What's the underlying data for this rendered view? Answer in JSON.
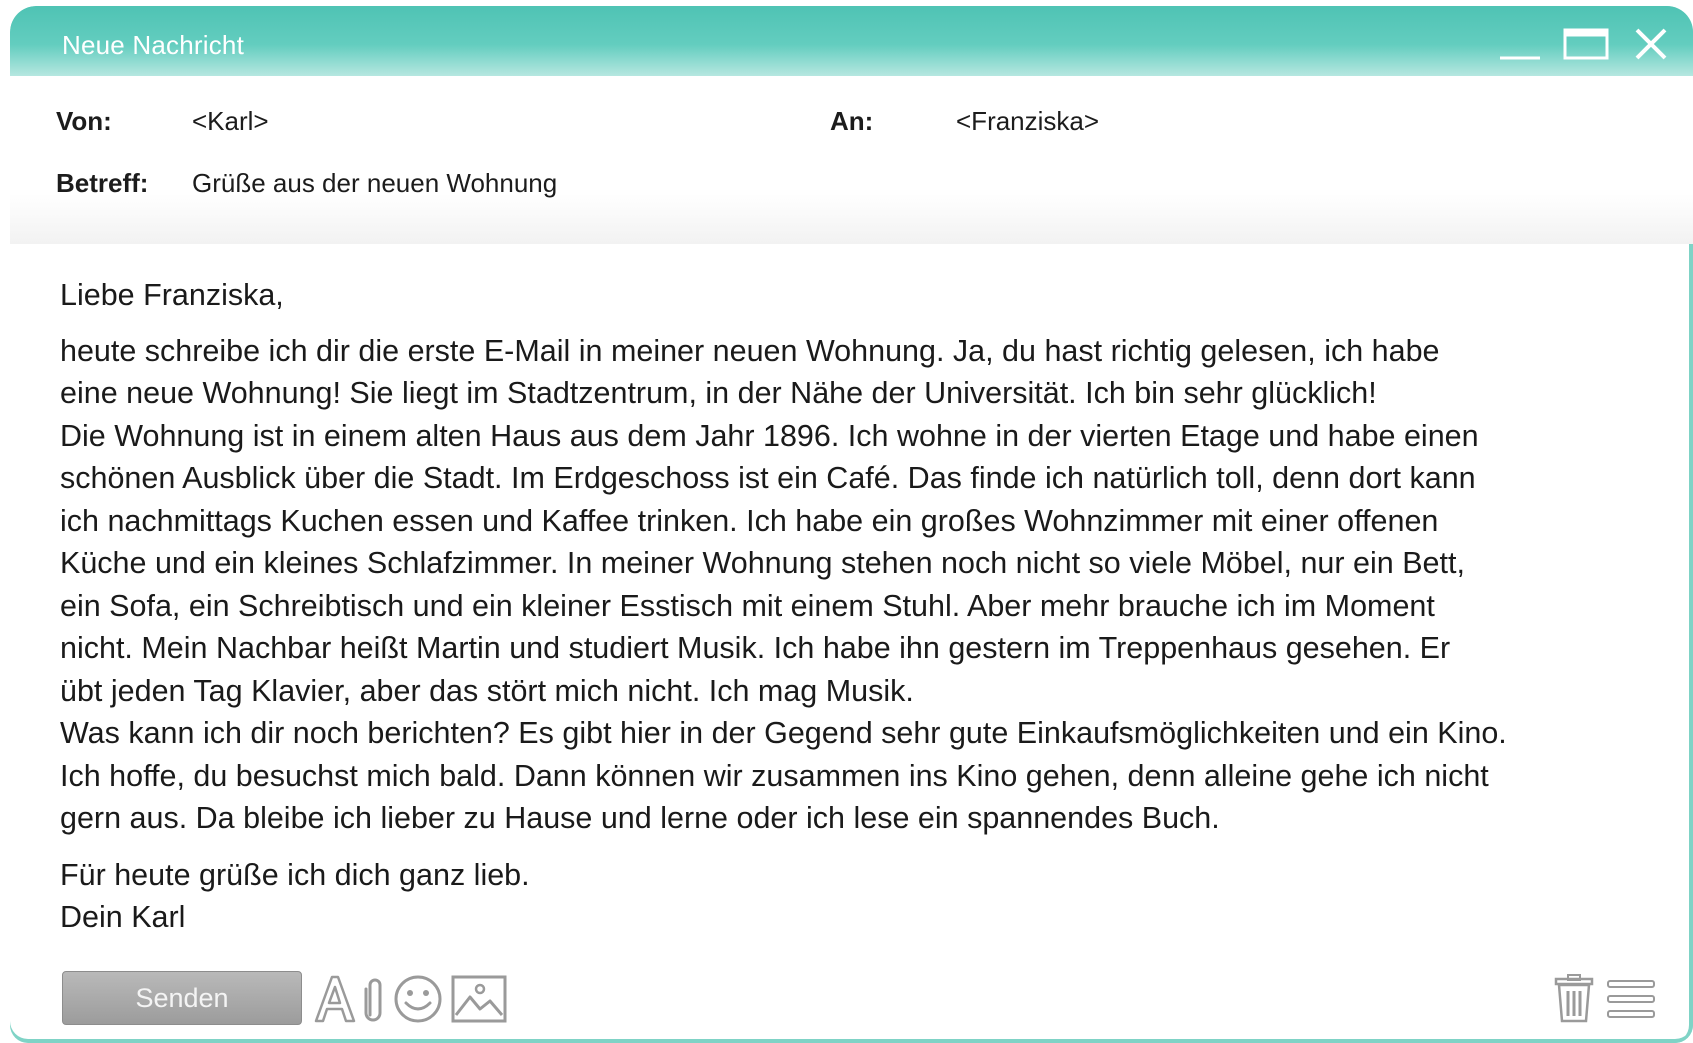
{
  "window": {
    "title": "Neue Nachricht",
    "accent_color": "#5cc8bb"
  },
  "header": {
    "from_label": "Von:",
    "from_value": "<Karl>",
    "to_label": "An:",
    "to_value": "<Franziska>",
    "subject_label": "Betreff:",
    "subject_value": "Grüße aus der neuen Wohnung"
  },
  "message": {
    "greeting": "Liebe Franziska,",
    "lines": [
      "heute schreibe ich dir die erste E-Mail in meiner neuen Wohnung. Ja, du hast richtig gelesen, ich habe",
      "eine neue Wohnung! Sie liegt im Stadtzentrum, in der Nähe der Universität. Ich bin sehr glücklich!",
      "Die Wohnung ist in einem alten Haus aus dem Jahr 1896. Ich wohne in der vierten Etage und habe einen",
      "schönen Ausblick über die Stadt. Im Erdgeschoss ist ein Café. Das finde ich natürlich toll, denn dort kann",
      "ich nachmittags Kuchen essen und Kaffee trinken. Ich habe ein großes Wohnzimmer mit einer offenen",
      "Küche und ein kleines Schlafzimmer. In meiner Wohnung stehen noch nicht so viele Möbel, nur ein Bett,",
      "ein Sofa, ein Schreibtisch und ein kleiner Esstisch mit einem Stuhl. Aber mehr brauche ich im Moment",
      "nicht. Mein Nachbar heißt Martin und studiert Musik. Ich habe ihn gestern im Treppenhaus gesehen. Er",
      "übt jeden Tag Klavier, aber das stört mich nicht. Ich mag Musik.",
      "Was kann ich dir noch berichten? Es gibt hier in der Gegend sehr gute Einkaufsmöglichkeiten und ein Kino.",
      "Ich hoffe, du besuchst mich bald. Dann können wir zusammen ins Kino gehen, denn alleine gehe ich nicht",
      "gern aus. Da bleibe ich lieber zu Hause und lerne oder ich lese ein spannendes Buch."
    ],
    "closing": "Für heute grüße ich dich ganz lieb.",
    "signature": "Dein Karl"
  },
  "footer": {
    "send_label": "Senden",
    "icons": [
      "text-format-icon",
      "attachment-icon",
      "emoji-icon",
      "image-icon",
      "trash-icon",
      "menu-icon"
    ]
  }
}
